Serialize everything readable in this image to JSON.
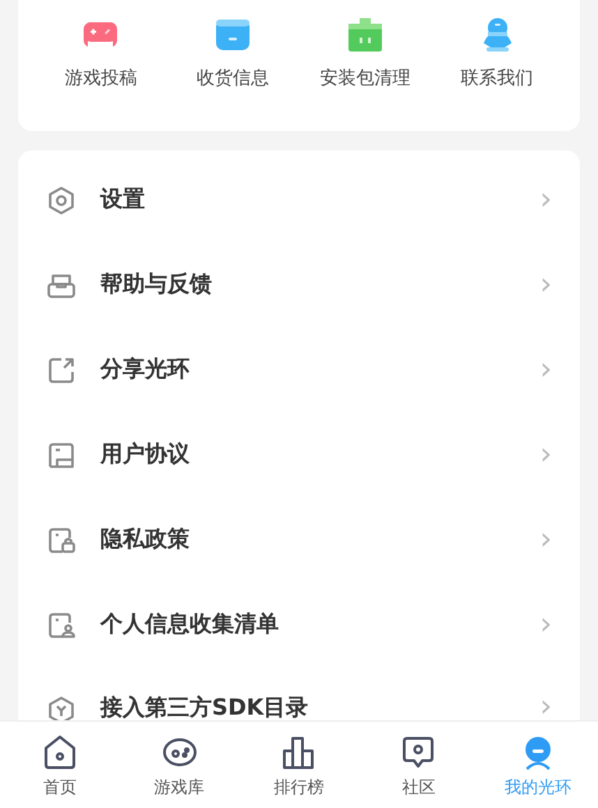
{
  "shortcuts": [
    {
      "label": "游戏投稿"
    },
    {
      "label": "收货信息"
    },
    {
      "label": "安装包清理"
    },
    {
      "label": "联系我们"
    }
  ],
  "menu": [
    {
      "label": "设置",
      "arrow": "›"
    },
    {
      "label": "帮助与反馈",
      "arrow": "›"
    },
    {
      "label": "分享光环",
      "arrow": "›"
    },
    {
      "label": "用户协议",
      "arrow": "›"
    },
    {
      "label": "隐私政策",
      "arrow": "›"
    },
    {
      "label": "个人信息收集清单",
      "arrow": "›"
    },
    {
      "label": "接入第三方SDK目录",
      "arrow": "›"
    }
  ],
  "tabs": [
    {
      "label": "首页",
      "selected": false
    },
    {
      "label": "游戏库",
      "selected": false
    },
    {
      "label": "排行榜",
      "selected": false
    },
    {
      "label": "社区",
      "selected": false
    },
    {
      "label": "我的光环",
      "selected": true
    }
  ]
}
